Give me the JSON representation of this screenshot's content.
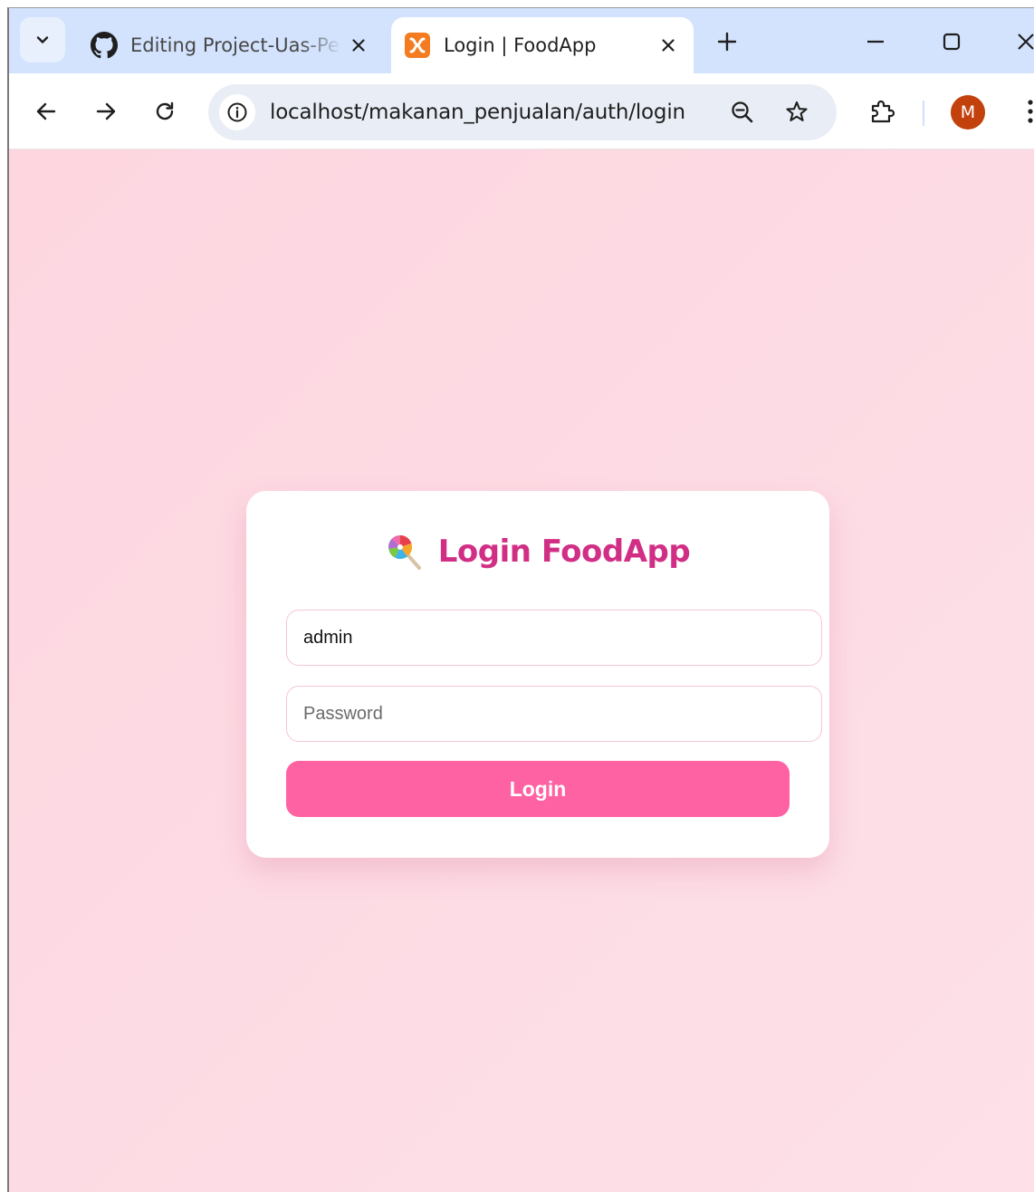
{
  "browser": {
    "tabs": [
      {
        "title": "Editing Project-Uas-Pe",
        "favicon": "github-icon",
        "active": false
      },
      {
        "title": "Login | FoodApp",
        "favicon": "xampp-icon",
        "active": true
      }
    ],
    "url": "localhost/makanan_penjualan/auth/login",
    "profile_initial": "M"
  },
  "login": {
    "title": "Login FoodApp",
    "title_icon": "lollipop-icon",
    "username_value": "admin",
    "password_placeholder": "Password",
    "button_label": "Login"
  },
  "colors": {
    "accent": "#ff62a3",
    "title": "#d12f85",
    "background": "#fdd6e0",
    "field_border": "#f5c6d6",
    "avatar": "#c2410c"
  }
}
